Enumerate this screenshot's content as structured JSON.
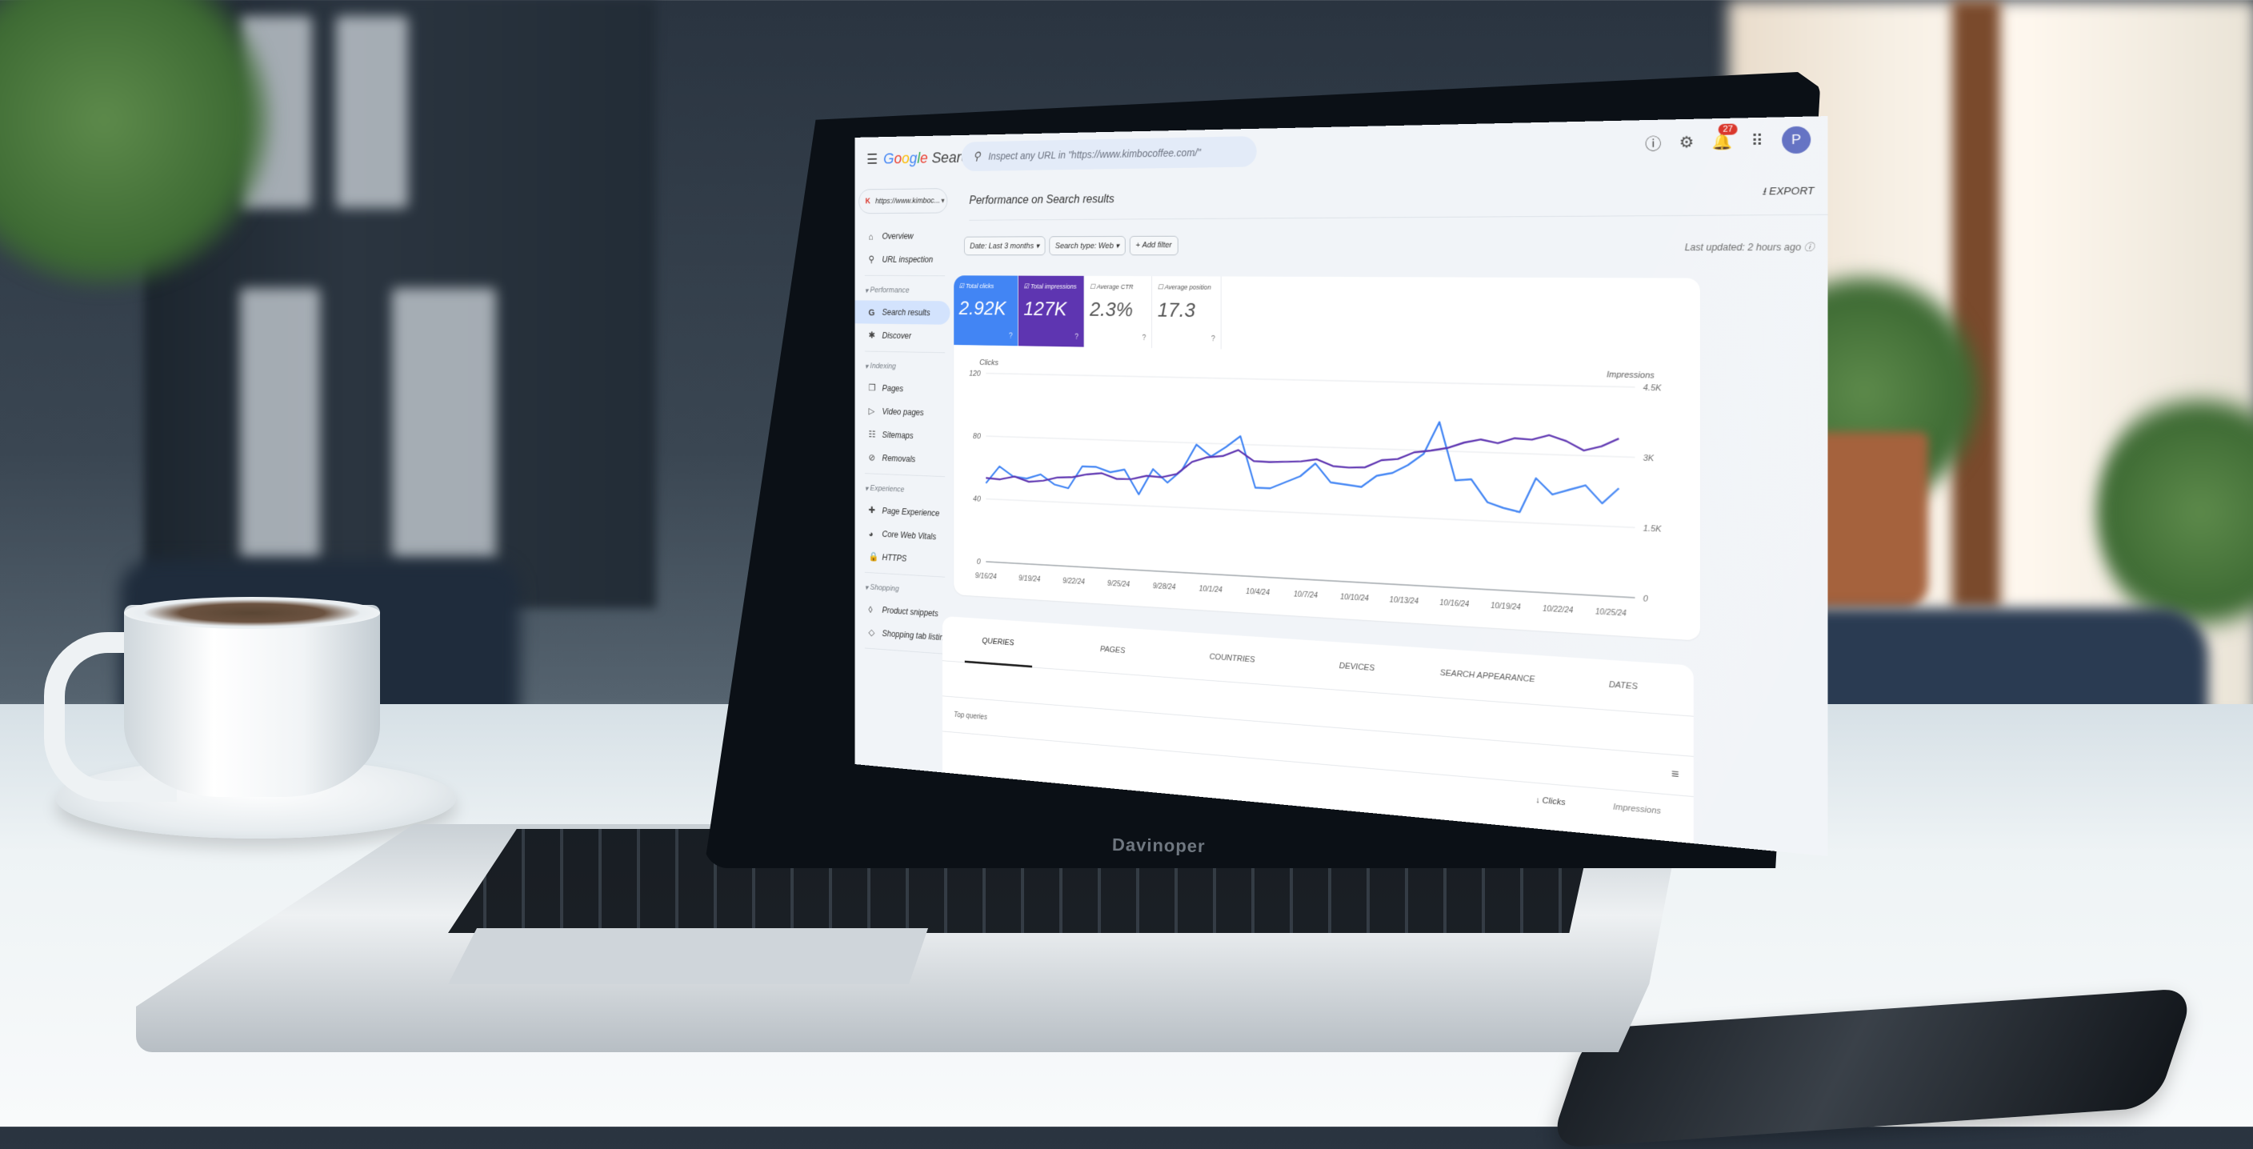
{
  "app": {
    "title_parts": [
      "G",
      "o",
      "o",
      "g",
      "l",
      "e"
    ],
    "title_suffix": "Search Console",
    "search_placeholder": "Inspect any URL in \"https://www.kimbocoffee.com/\"",
    "notifications_count": "27",
    "avatar_initial": "P",
    "laptop_brand": "Davinoper"
  },
  "sidebar": {
    "property": {
      "favicon": "K",
      "label": "https://www.kimboc..."
    },
    "top_items": [
      {
        "label": "Overview",
        "icon": "home-icon"
      },
      {
        "label": "URL inspection",
        "icon": "search-icon"
      }
    ],
    "sections": [
      {
        "title": "Performance",
        "items": [
          {
            "label": "Search results",
            "icon": "google-g-icon",
            "active": true
          },
          {
            "label": "Discover",
            "icon": "asterisk-icon"
          }
        ]
      },
      {
        "title": "Indexing",
        "items": [
          {
            "label": "Pages",
            "icon": "pages-icon"
          },
          {
            "label": "Video pages",
            "icon": "video-pages-icon"
          },
          {
            "label": "Sitemaps",
            "icon": "sitemap-icon"
          },
          {
            "label": "Removals",
            "icon": "removals-icon"
          }
        ]
      },
      {
        "title": "Experience",
        "items": [
          {
            "label": "Page Experience",
            "icon": "page-experience-icon"
          },
          {
            "label": "Core Web Vitals",
            "icon": "gauge-icon"
          },
          {
            "label": "HTTPS",
            "icon": "lock-icon"
          }
        ]
      },
      {
        "title": "Shopping",
        "items": [
          {
            "label": "Product snippets",
            "icon": "product-snippets-icon"
          },
          {
            "label": "Shopping tab listings",
            "icon": "tag-icon"
          }
        ]
      }
    ]
  },
  "main": {
    "page_title": "Performance on Search results",
    "export_label": "EXPORT",
    "filters": [
      {
        "label": "Date: Last 3 months",
        "dropdown": true
      },
      {
        "label": "Search type: Web",
        "dropdown": true
      },
      {
        "label": "Add filter",
        "plus": true
      }
    ],
    "last_updated": "Last updated: 2 hours ago",
    "metrics": [
      {
        "key": "clicks",
        "label": "Total clicks",
        "value": "2.92K",
        "checked": true,
        "color": "#4285f4"
      },
      {
        "key": "impr",
        "label": "Total impressions",
        "value": "127K",
        "checked": true,
        "color": "#5e35b1"
      },
      {
        "key": "ctr",
        "label": "Average CTR",
        "value": "2.3%",
        "checked": false
      },
      {
        "key": "pos",
        "label": "Average position",
        "value": "17.3",
        "checked": false
      }
    ],
    "tabs": [
      {
        "label": "QUERIES",
        "active": true
      },
      {
        "label": "PAGES"
      },
      {
        "label": "COUNTRIES"
      },
      {
        "label": "DEVICES"
      },
      {
        "label": "SEARCH APPEARANCE"
      },
      {
        "label": "DATES"
      }
    ],
    "table": {
      "title": "Top queries",
      "columns": [
        "Clicks",
        "Impressions"
      ],
      "sort_column": "Clicks"
    }
  },
  "chart_data": {
    "type": "line",
    "title": "",
    "left_axis_label": "Clicks",
    "right_axis_label": "Impressions",
    "left_ylim": [
      0,
      120
    ],
    "right_ylim": [
      0,
      4500
    ],
    "left_ticks": [
      "0",
      "40",
      "80",
      "120"
    ],
    "right_ticks": [
      "0",
      "1.5K",
      "3K",
      "4.5K"
    ],
    "x_tick_labels": [
      "9/16/24",
      "9/19/24",
      "9/22/24",
      "9/25/24",
      "9/28/24",
      "10/1/24",
      "10/4/24",
      "10/7/24",
      "10/10/24",
      "10/13/24",
      "10/16/24",
      "10/19/24",
      "10/22/24",
      "10/25/24"
    ],
    "x_start": "9/16/24",
    "x_end": "10/27/24",
    "grid": true,
    "series": [
      {
        "name": "Clicks",
        "axis": "left",
        "color": "#4285f4",
        "values": [
          50,
          61,
          55,
          54,
          57,
          51,
          49,
          63,
          63,
          60,
          62,
          47,
          63,
          55,
          63,
          79,
          72,
          78,
          85,
          54,
          54,
          58,
          62,
          70,
          59,
          58,
          57,
          64,
          66,
          71,
          78,
          97,
          63,
          64,
          51,
          48,
          46,
          66,
          57,
          60,
          63,
          53,
          62
        ]
      },
      {
        "name": "Impressions",
        "axis": "right",
        "color": "#5e35b1",
        "values": [
          2000,
          1980,
          2060,
          1950,
          1990,
          2080,
          2100,
          2180,
          2220,
          2100,
          2110,
          2200,
          2180,
          2270,
          2560,
          2680,
          2720,
          2870,
          2630,
          2620,
          2640,
          2660,
          2720,
          2580,
          2560,
          2580,
          2750,
          2790,
          2950,
          3000,
          3070,
          3200,
          3280,
          3210,
          3330,
          3310,
          3420,
          3300,
          3110,
          3210,
          3390
        ]
      }
    ]
  }
}
